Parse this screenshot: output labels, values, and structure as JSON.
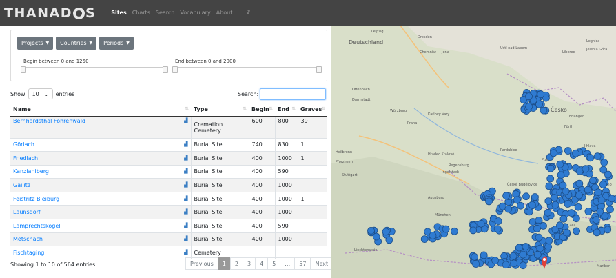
{
  "nav": {
    "logo": [
      "T",
      "H",
      "A",
      "N",
      "A",
      "D",
      "S"
    ],
    "links": [
      "Sites",
      "Charts",
      "Search",
      "Vocabulary",
      "About"
    ],
    "help": "?"
  },
  "filters": {
    "dropdowns": [
      "Projects",
      "Countries",
      "Periods"
    ],
    "begin_label": "Begin between 0 and 1250",
    "end_label": "End between 0 and 2000"
  },
  "table": {
    "show": "Show",
    "length": "10",
    "entries": "entries",
    "search_label": "Search:",
    "headers": [
      "Name",
      "Type",
      "Begin",
      "End",
      "Graves"
    ],
    "rows": [
      {
        "name": "Bernhardsthal Föhrenwald",
        "type": "Cremation Cemetery",
        "begin": "600",
        "end": "800",
        "graves": "39"
      },
      {
        "name": "Göriach",
        "type": "Burial Site",
        "begin": "740",
        "end": "830",
        "graves": "1"
      },
      {
        "name": "Friedlach",
        "type": "Burial Site",
        "begin": "400",
        "end": "1000",
        "graves": "1"
      },
      {
        "name": "Kanzianiberg",
        "type": "Burial Site",
        "begin": "400",
        "end": "590",
        "graves": ""
      },
      {
        "name": "Gailitz",
        "type": "Burial Site",
        "begin": "400",
        "end": "1000",
        "graves": ""
      },
      {
        "name": "Feistritz Bleiburg",
        "type": "Burial Site",
        "begin": "400",
        "end": "1000",
        "graves": "1"
      },
      {
        "name": "Launsdorf",
        "type": "Burial Site",
        "begin": "400",
        "end": "1000",
        "graves": ""
      },
      {
        "name": "Lamprechtskogel",
        "type": "Burial Site",
        "begin": "400",
        "end": "590",
        "graves": ""
      },
      {
        "name": "Metschach",
        "type": "Burial Site",
        "begin": "400",
        "end": "1000",
        "graves": ""
      },
      {
        "name": "Fischtaging",
        "type": "Cemetery",
        "begin": "",
        "end": "",
        "graves": ""
      }
    ],
    "info": "Showing 1 to 10 of 564 entries",
    "pager": [
      "Previous",
      "1",
      "2",
      "3",
      "4",
      "5",
      "…",
      "57",
      "Next"
    ]
  },
  "map": {
    "labels": [
      "Leipzig",
      "Deutschland",
      "Dresden",
      "Chemnitz",
      "Jena",
      "Ústí nad Labem",
      "Legnica",
      "Jelenia Góra",
      "Liberec",
      "Offenbach",
      "Darmstadt",
      "Würzburg",
      "Karlovy Vary",
      "Praha",
      "Hradec Králové",
      "Pardubice",
      "Česko",
      "Erlangen",
      "Fürth",
      "Plzeň",
      "Jihlava",
      "Heilbronn",
      "Pforzheim",
      "Stuttgart",
      "Regensburg",
      "Ingolstadt",
      "České Budějovice",
      "Brno",
      "Augsburg",
      "München",
      "Liechtenstein",
      "Zell",
      "Maribor"
    ]
  },
  "colors": {
    "link": "#007bff",
    "marker": "#2f7bd1",
    "pin": "#e0413a"
  }
}
